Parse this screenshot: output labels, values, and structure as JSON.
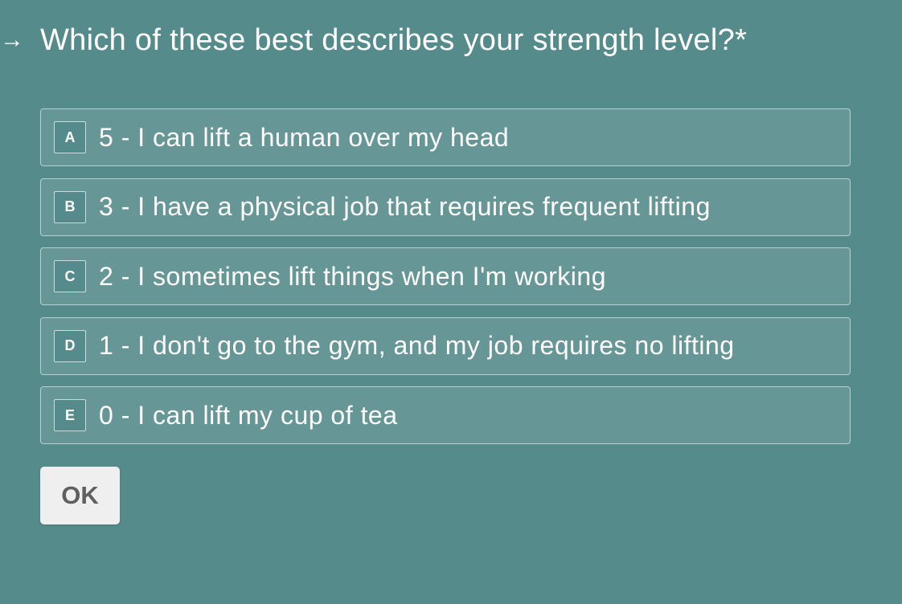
{
  "question": {
    "arrow": "→",
    "text": "Which of these best describes your strength level?",
    "required_marker": "*"
  },
  "options": [
    {
      "key": "A",
      "label": "5 - I can lift a human over my head"
    },
    {
      "key": "B",
      "label": "3 - I have a physical job that requires frequent lifting"
    },
    {
      "key": "C",
      "label": "2 - I sometimes lift things when I'm working"
    },
    {
      "key": "D",
      "label": "1 - I don't go to the gym, and my job requires no lifting"
    },
    {
      "key": "E",
      "label": "0 - I can lift my cup of tea"
    }
  ],
  "ok_button": {
    "label": "OK"
  },
  "colors": {
    "background": "#568b8c",
    "text": "#ffffff",
    "button_bg": "#efefef",
    "button_text": "#5f5f5f"
  },
  "icons": {
    "question_arrow": "arrow-right-icon"
  }
}
